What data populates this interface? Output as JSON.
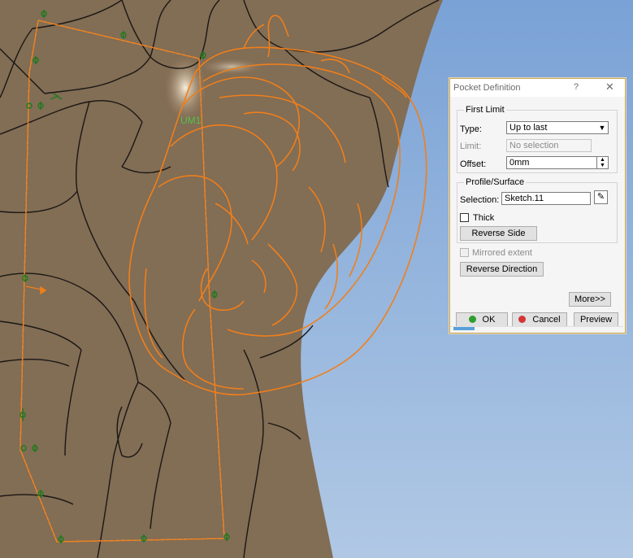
{
  "viewport": {
    "annotation_label": "UM1",
    "colors": {
      "surface": "#826d55",
      "background_sky": "#8aacd8",
      "profile": "#f07f1a",
      "constraint": "#1d7a1d",
      "edges": "#1a1714"
    }
  },
  "dialog": {
    "title": "Pocket Definition",
    "help": "?",
    "close": "✕",
    "first_limit": {
      "legend": "First Limit",
      "type_label": "Type:",
      "type_value": "Up to last",
      "limit_label": "Limit:",
      "limit_value": "No selection",
      "offset_label": "Offset:",
      "offset_value": "0mm"
    },
    "profile": {
      "legend": "Profile/Surface",
      "selection_label": "Selection:",
      "selection_value": "Sketch.11",
      "thick_label": "Thick",
      "reverse_side_label": "Reverse Side"
    },
    "mirrored_label": "Mirrored extent",
    "reverse_direction_label": "Reverse Direction",
    "more_label": "More>>",
    "ok_label": "OK",
    "cancel_label": "Cancel",
    "preview_label": "Preview"
  }
}
